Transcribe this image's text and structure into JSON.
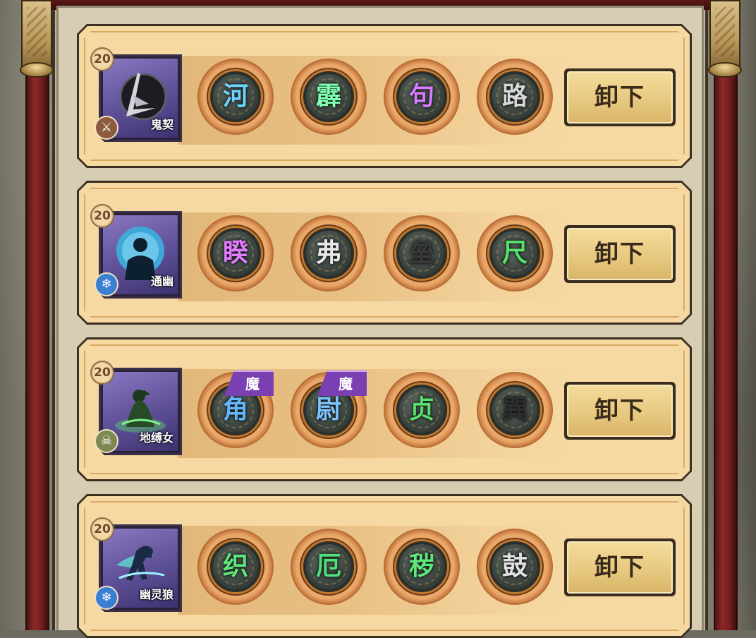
{
  "unequip_label": "卸下",
  "mo_tag_label": "魔",
  "colors": {
    "card_face": "#f6d9a2",
    "rune_ring": "#e9a768",
    "mo_tag": "#7a3fb0",
    "button_face": "#e6c77e"
  },
  "rows": [
    {
      "level": "20",
      "name": "鬼契",
      "type_icon": "sword-icon",
      "runes": [
        {
          "glyph": "河",
          "color": "#6fd6ff",
          "tag": ""
        },
        {
          "glyph": "霹",
          "color": "#7fffb0",
          "tag": ""
        },
        {
          "glyph": "句",
          "color": "#d77bff",
          "tag": ""
        },
        {
          "glyph": "路",
          "color": "#d8d8d8",
          "tag": ""
        }
      ]
    },
    {
      "level": "20",
      "name": "通幽",
      "type_icon": "snowflake-icon",
      "runes": [
        {
          "glyph": "睽",
          "color": "#e37bff",
          "tag": ""
        },
        {
          "glyph": "弗",
          "color": "#e8e8e8",
          "tag": ""
        },
        {
          "glyph": "垒",
          "color": "#3a3a3a",
          "tag": ""
        },
        {
          "glyph": "尺",
          "color": "#54e56b",
          "tag": ""
        }
      ]
    },
    {
      "level": "20",
      "name": "地缚女",
      "type_icon": "skull-icon",
      "runes": [
        {
          "glyph": "角",
          "color": "#63b7ff",
          "tag": "魔"
        },
        {
          "glyph": "尉",
          "color": "#7ec4ff",
          "tag": "魔"
        },
        {
          "glyph": "贞",
          "color": "#59e06a",
          "tag": ""
        },
        {
          "glyph": "巽",
          "color": "#2e2e2e",
          "tag": ""
        }
      ]
    },
    {
      "level": "20",
      "name": "幽灵狼",
      "type_icon": "snowflake-icon",
      "runes": [
        {
          "glyph": "织",
          "color": "#5fe87a",
          "tag": ""
        },
        {
          "glyph": "厄",
          "color": "#4fe07b",
          "tag": ""
        },
        {
          "glyph": "秽",
          "color": "#5fe87a",
          "tag": ""
        },
        {
          "glyph": "鼓",
          "color": "#e0e0e0",
          "tag": ""
        }
      ]
    }
  ]
}
